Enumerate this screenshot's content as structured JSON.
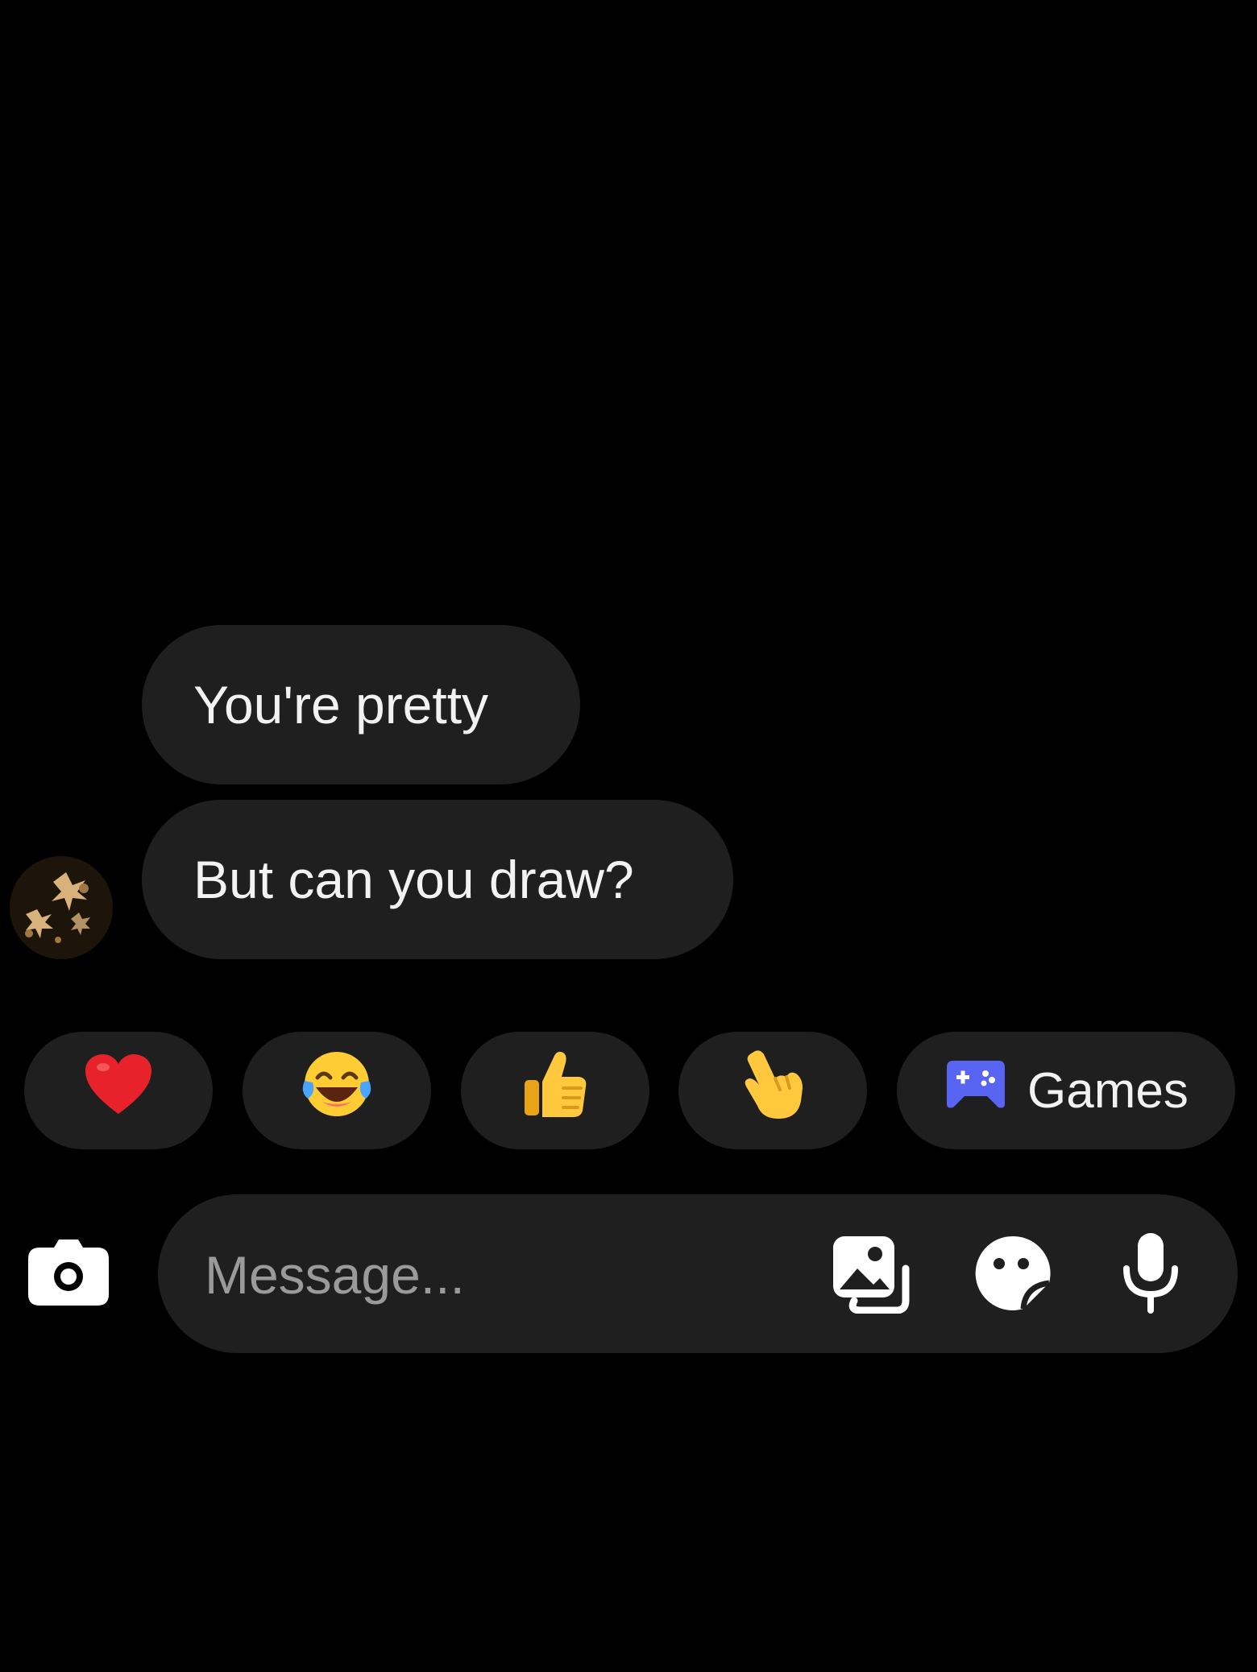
{
  "messages": [
    {
      "text": "You're pretty"
    },
    {
      "text": "But can you draw?"
    }
  ],
  "quick_reactions": {
    "heart": "❤",
    "laugh": "😂",
    "thumbs_up": "👍",
    "hand": "👆",
    "games_label": "Games"
  },
  "composer": {
    "placeholder": "Message..."
  },
  "icons": {
    "camera": "camera-icon",
    "gallery": "gallery-icon",
    "sticker": "sticker-icon",
    "microphone": "microphone-icon",
    "games": "gamepad-icon"
  },
  "colors": {
    "background": "#000000",
    "bubble": "#1f1f1f",
    "games_icon": "#5865f2",
    "heart": "#e8222a"
  }
}
